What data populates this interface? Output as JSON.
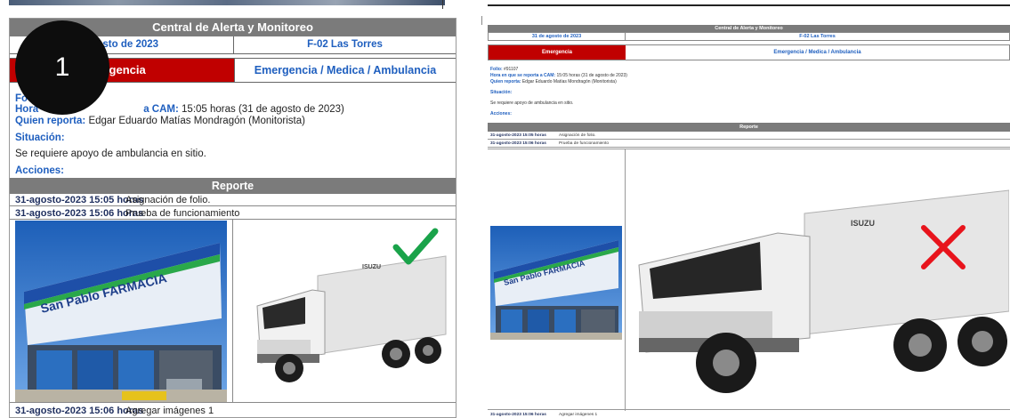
{
  "header": {
    "title": "Central de Alerta y Monitoreo",
    "fecha": "31 de agosto de 2023",
    "fecha_visible": "agosto de 2023",
    "ubicacion": "F-02 Las Torres",
    "tipo": "Emergencia",
    "tipo_visible": "ergencia",
    "categoria": "Emergencia / Medica / Ambulancia"
  },
  "details": {
    "folio_label": "Folio:",
    "folio_visible": "Fo",
    "folio_value": "#91107",
    "hora_label": "Hora en que se reporta a CAM:",
    "hora_label_visible": "Hora",
    "hora_label_tail": "a CAM:",
    "hora_value": "15:05 horas (31 de agosto de 2023)",
    "quien_label": "Quien reporta:",
    "quien_value": "Edgar Eduardo Matías Mondragón  (Monitorista)",
    "quien_value_small": "Edgar Eduardo Matías Mondragón  (Monitorista)",
    "situacion_label": "Situación:",
    "situacion_value": "Se requiere apoyo de ambulancia en sitio.",
    "acciones_label": "Acciones:"
  },
  "report": {
    "title": "Reporte",
    "entries": [
      {
        "date": "31-agosto-2023 15:05 horas",
        "text": "Asignación de folio."
      },
      {
        "date": "31-agosto-2023 15:06 horas",
        "text": "Prueba de funcionamiento"
      }
    ],
    "last_entry": {
      "date": "31-agosto-2023 15:06 horas",
      "text": "Agregar imágenes 1"
    }
  },
  "images": {
    "storefront_sign": "San Pablo FARMACIA",
    "truck_brand": "ISUZU",
    "left_mark": "check-icon",
    "right_mark": "cross-icon"
  },
  "annotation": {
    "step_number": "1"
  },
  "colors": {
    "header_gray": "#7b7b7b",
    "emergency_red": "#c00000",
    "label_blue": "#1f5fbf",
    "check_green": "#1aa34a",
    "cross_red": "#e8141c"
  }
}
